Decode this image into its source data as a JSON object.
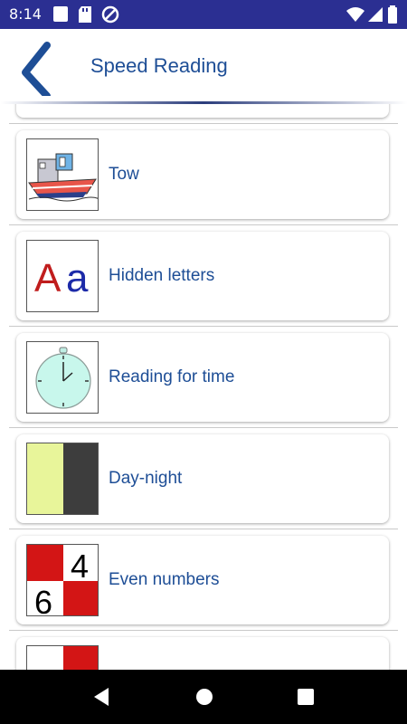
{
  "status_bar": {
    "time": "8:14"
  },
  "header": {
    "title": "Speed Reading"
  },
  "exercises": [
    {
      "label": "Tow",
      "icon": "boat-icon"
    },
    {
      "label": "Hidden letters",
      "icon": "letters-aa-icon",
      "icon_text_1": "A",
      "icon_text_2": "a"
    },
    {
      "label": "Reading for time",
      "icon": "stopwatch-icon"
    },
    {
      "label": "Day-night",
      "icon": "day-night-icon"
    },
    {
      "label": "Even numbers",
      "icon": "numbers-grid-icon",
      "icon_text_1": "4",
      "icon_text_2": "6"
    }
  ],
  "colors": {
    "accent": "#1e4e96",
    "status_bar": "#2b2f92"
  }
}
